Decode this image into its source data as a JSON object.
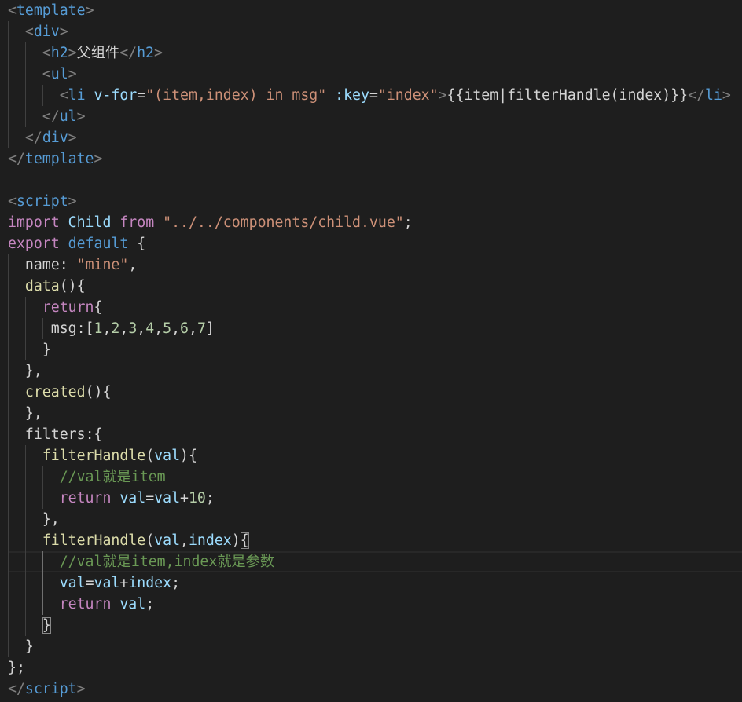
{
  "theme": {
    "background": "#1e1e1e",
    "current_line_border": "#282828",
    "indent_guide": "#404040",
    "indent_guide_active": "#707070",
    "bracket_match_border": "#888888",
    "tokens": {
      "p": "#808080",
      "tag": "#569cd6",
      "attr": "#9cdcfe",
      "str": "#ce9178",
      "txt": "#d4d4d4",
      "kw": "#c586c0",
      "kw2": "#569cd6",
      "var": "#9cdcfe",
      "key": "#d4d4d4",
      "fn": "#dcdcaa",
      "num": "#b5cea8",
      "cm": "#6a9955"
    }
  },
  "editor": {
    "active_line": 27,
    "lines": [
      [
        [
          "<",
          "p"
        ],
        [
          "template",
          "tag"
        ],
        [
          ">",
          "p"
        ]
      ],
      [
        [
          "  ",
          "txt"
        ],
        [
          "<",
          "p"
        ],
        [
          "div",
          "tag"
        ],
        [
          ">",
          "p"
        ]
      ],
      [
        [
          "    ",
          "txt"
        ],
        [
          "<",
          "p"
        ],
        [
          "h2",
          "tag"
        ],
        [
          ">",
          "p"
        ],
        [
          "父组件",
          "txt"
        ],
        [
          "</",
          "p"
        ],
        [
          "h2",
          "tag"
        ],
        [
          ">",
          "p"
        ]
      ],
      [
        [
          "    ",
          "txt"
        ],
        [
          "<",
          "p"
        ],
        [
          "ul",
          "tag"
        ],
        [
          ">",
          "p"
        ]
      ],
      [
        [
          "      ",
          "txt"
        ],
        [
          "<",
          "p"
        ],
        [
          "li",
          "tag"
        ],
        [
          " ",
          "txt"
        ],
        [
          "v-for",
          "attr"
        ],
        [
          "=",
          "txt"
        ],
        [
          "\"(item,index) in msg\"",
          "str"
        ],
        [
          " ",
          "txt"
        ],
        [
          ":key",
          "attr"
        ],
        [
          "=",
          "txt"
        ],
        [
          "\"index\"",
          "str"
        ],
        [
          ">",
          "p"
        ],
        [
          "{{item|filterHandle(index)}}",
          "txt"
        ],
        [
          "</",
          "p"
        ],
        [
          "li",
          "tag"
        ],
        [
          ">",
          "p"
        ]
      ],
      [
        [
          "    ",
          "txt"
        ],
        [
          "</",
          "p"
        ],
        [
          "ul",
          "tag"
        ],
        [
          ">",
          "p"
        ]
      ],
      [
        [
          "  ",
          "txt"
        ],
        [
          "</",
          "p"
        ],
        [
          "div",
          "tag"
        ],
        [
          ">",
          "p"
        ]
      ],
      [
        [
          "</",
          "p"
        ],
        [
          "template",
          "tag"
        ],
        [
          ">",
          "p"
        ]
      ],
      [],
      [
        [
          "<",
          "p"
        ],
        [
          "script",
          "tag"
        ],
        [
          ">",
          "p"
        ]
      ],
      [
        [
          "import",
          "kw"
        ],
        [
          " ",
          "txt"
        ],
        [
          "Child",
          "var"
        ],
        [
          " ",
          "txt"
        ],
        [
          "from",
          "kw"
        ],
        [
          " ",
          "txt"
        ],
        [
          "\"../../components/child.vue\"",
          "str"
        ],
        [
          ";",
          "txt"
        ]
      ],
      [
        [
          "export",
          "kw"
        ],
        [
          " ",
          "txt"
        ],
        [
          "default",
          "kw2"
        ],
        [
          " {",
          "txt"
        ]
      ],
      [
        [
          "  ",
          "txt"
        ],
        [
          "name",
          "key"
        ],
        [
          ": ",
          "txt"
        ],
        [
          "\"mine\"",
          "str"
        ],
        [
          ",",
          "txt"
        ]
      ],
      [
        [
          "  ",
          "txt"
        ],
        [
          "data",
          "fn"
        ],
        [
          "(){",
          "txt"
        ]
      ],
      [
        [
          "    ",
          "txt"
        ],
        [
          "return",
          "kw"
        ],
        [
          "{",
          "txt"
        ]
      ],
      [
        [
          "     ",
          "txt"
        ],
        [
          "msg",
          "key"
        ],
        [
          ":[",
          "txt"
        ],
        [
          "1",
          "num"
        ],
        [
          ",",
          "txt"
        ],
        [
          "2",
          "num"
        ],
        [
          ",",
          "txt"
        ],
        [
          "3",
          "num"
        ],
        [
          ",",
          "txt"
        ],
        [
          "4",
          "num"
        ],
        [
          ",",
          "txt"
        ],
        [
          "5",
          "num"
        ],
        [
          ",",
          "txt"
        ],
        [
          "6",
          "num"
        ],
        [
          ",",
          "txt"
        ],
        [
          "7",
          "num"
        ],
        [
          "]",
          "txt"
        ]
      ],
      [
        [
          "    ",
          "txt"
        ],
        [
          "}",
          "txt"
        ]
      ],
      [
        [
          "  ",
          "txt"
        ],
        [
          "},",
          "txt"
        ]
      ],
      [
        [
          "  ",
          "txt"
        ],
        [
          "created",
          "fn"
        ],
        [
          "(){",
          "txt"
        ]
      ],
      [
        [
          "  ",
          "txt"
        ],
        [
          "},",
          "txt"
        ]
      ],
      [
        [
          "  ",
          "txt"
        ],
        [
          "filters",
          "key"
        ],
        [
          ":{",
          "txt"
        ]
      ],
      [
        [
          "    ",
          "txt"
        ],
        [
          "filterHandle",
          "fn"
        ],
        [
          "(",
          "txt"
        ],
        [
          "val",
          "var"
        ],
        [
          "){",
          "txt"
        ]
      ],
      [
        [
          "      ",
          "txt"
        ],
        [
          "//val就是item",
          "cm"
        ]
      ],
      [
        [
          "      ",
          "txt"
        ],
        [
          "return",
          "kw"
        ],
        [
          " ",
          "txt"
        ],
        [
          "val",
          "var"
        ],
        [
          "=",
          "txt"
        ],
        [
          "val",
          "var"
        ],
        [
          "+",
          "txt"
        ],
        [
          "10",
          "num"
        ],
        [
          ";",
          "txt"
        ]
      ],
      [
        [
          "    ",
          "txt"
        ],
        [
          "},",
          "txt"
        ]
      ],
      [
        [
          "    ",
          "txt"
        ],
        [
          "filterHandle",
          "fn"
        ],
        [
          "(",
          "txt"
        ],
        [
          "val",
          "var"
        ],
        [
          ",",
          "txt"
        ],
        [
          "index",
          "var"
        ],
        [
          ")",
          "txt"
        ],
        [
          "{",
          "txt",
          "match"
        ]
      ],
      [
        [
          "      ",
          "txt"
        ],
        [
          "//val就是item,index就是参数",
          "cm"
        ]
      ],
      [
        [
          "      ",
          "txt"
        ],
        [
          "val",
          "var"
        ],
        [
          "=",
          "txt"
        ],
        [
          "val",
          "var"
        ],
        [
          "+",
          "txt"
        ],
        [
          "index",
          "var"
        ],
        [
          ";",
          "txt"
        ]
      ],
      [
        [
          "      ",
          "txt"
        ],
        [
          "return",
          "kw"
        ],
        [
          " ",
          "txt"
        ],
        [
          "val",
          "var"
        ],
        [
          ";",
          "txt"
        ]
      ],
      [
        [
          "    ",
          "txt"
        ],
        [
          "}",
          "txt",
          "match"
        ]
      ],
      [
        [
          "  ",
          "txt"
        ],
        [
          "}",
          "txt"
        ]
      ],
      [
        [
          "};",
          "txt"
        ]
      ],
      [
        [
          "</",
          "p"
        ],
        [
          "script",
          "tag"
        ],
        [
          ">",
          "p"
        ]
      ]
    ]
  }
}
